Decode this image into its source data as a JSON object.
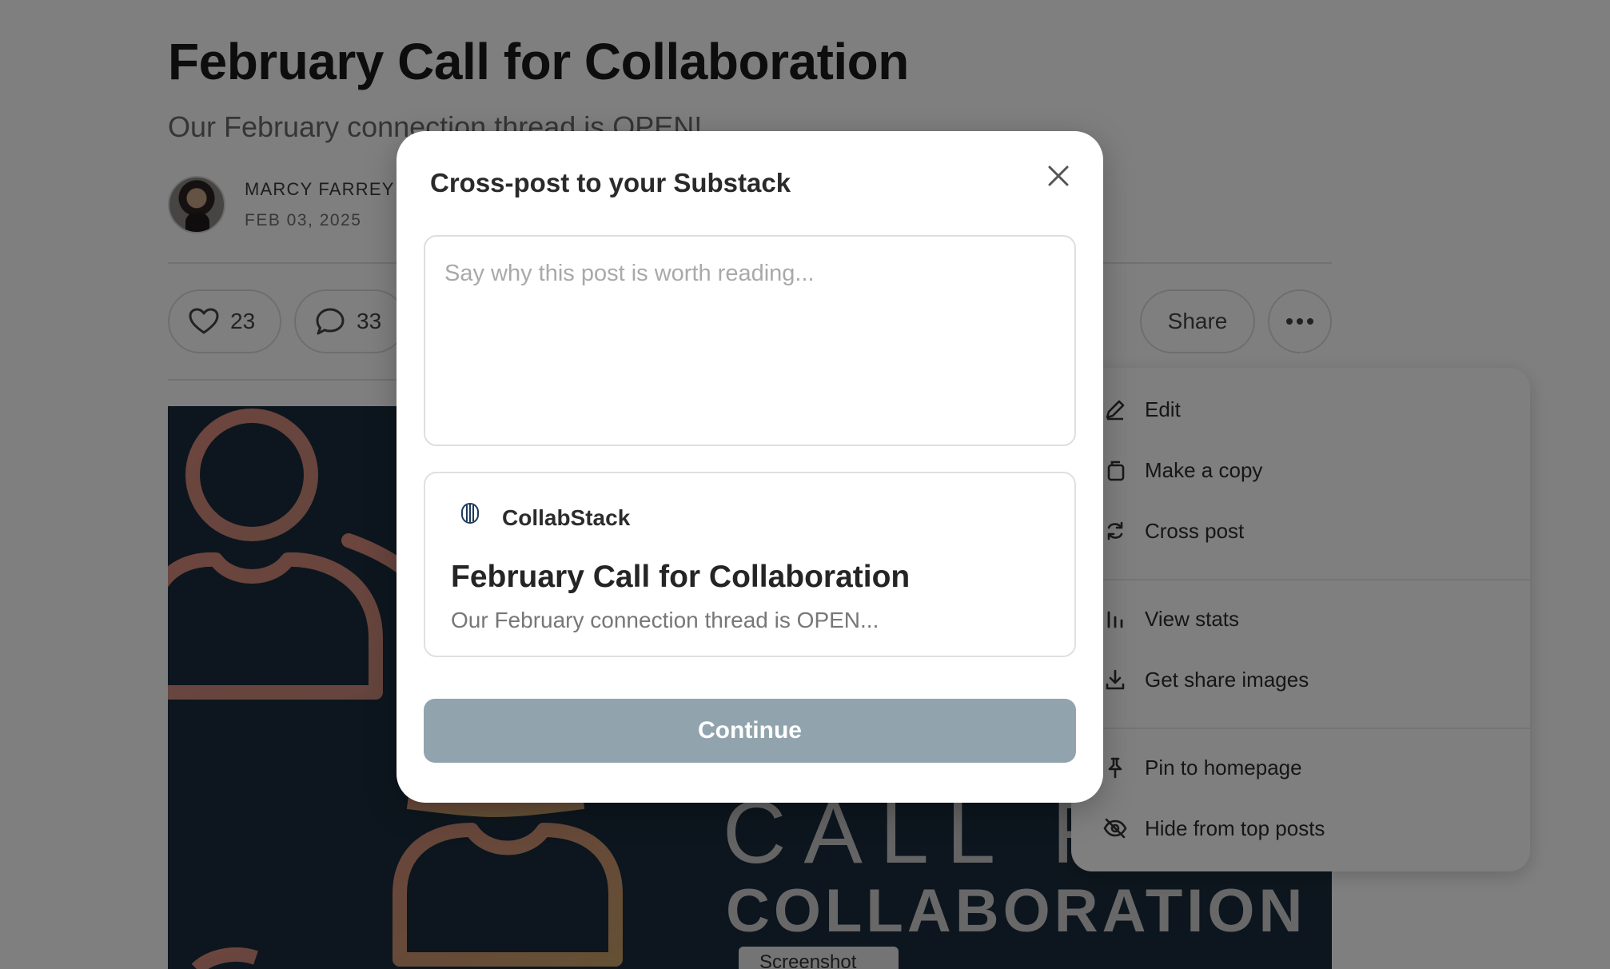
{
  "post": {
    "title": "February Call for Collaboration",
    "subtitle": "Our February connection thread is OPEN!",
    "author": "MARCY FARREY",
    "date": "FEB 03, 2025",
    "likes": "23",
    "comments": "33",
    "share_label": "Share"
  },
  "hero": {
    "line1": "CALL F",
    "line2": "COLLABORATION",
    "badge": "Screenshot",
    "accent_colors": [
      "#d98b7e",
      "#c9a06a"
    ],
    "background": "#1b2d3c"
  },
  "menu": {
    "items": [
      {
        "label": "Edit",
        "icon": "pencil-icon"
      },
      {
        "label": "Make a copy",
        "icon": "copy-icon"
      },
      {
        "label": "Cross post",
        "icon": "cross-post-icon"
      },
      {
        "label": "View stats",
        "icon": "bar-chart-icon"
      },
      {
        "label": "Get share images",
        "icon": "download-icon"
      },
      {
        "label": "Pin to homepage",
        "icon": "pin-icon"
      },
      {
        "label": "Hide from top posts",
        "icon": "eye-off-icon"
      }
    ]
  },
  "modal": {
    "title": "Cross-post to your Substack",
    "placeholder": "Say why this post is worth reading...",
    "publication": "CollabStack",
    "logo_text": "COLLAB STACK",
    "preview_title": "February Call for Collaboration",
    "preview_subtitle": "Our February connection thread is OPEN...",
    "continue_label": "Continue",
    "continue_color": "#91a4ad"
  }
}
